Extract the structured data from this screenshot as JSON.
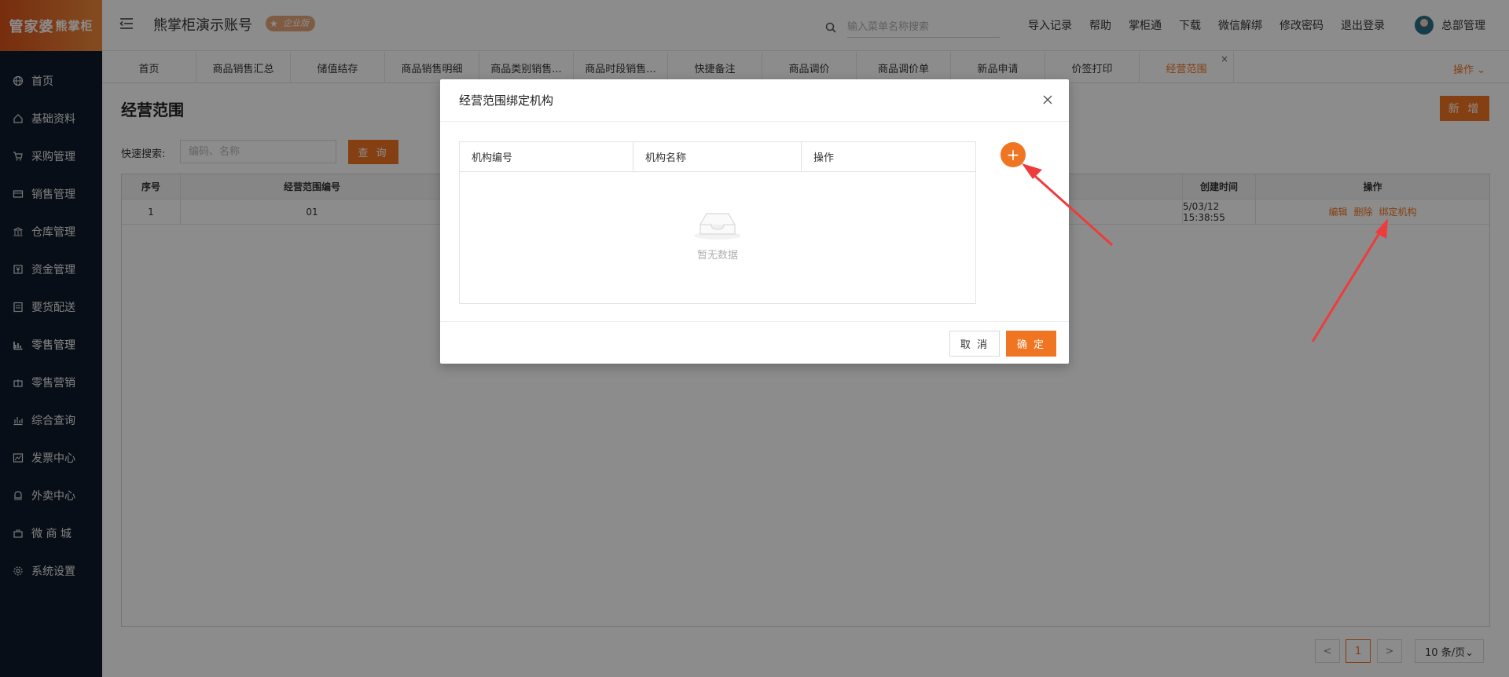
{
  "logo": {
    "text_a": "管家婆",
    "text_b": "熊掌柜"
  },
  "header": {
    "account": "熊掌柜演示账号",
    "edition": "企业版",
    "search_placeholder": "输入菜单名称搜索",
    "links": [
      "导入记录",
      "帮助",
      "掌柜通",
      "下载",
      "微信解绑",
      "修改密码",
      "退出登录"
    ],
    "user": "总部管理"
  },
  "sidebar": {
    "items": [
      {
        "label": "首页",
        "icon": "globe-icon"
      },
      {
        "label": "基础资料",
        "icon": "home-icon"
      },
      {
        "label": "采购管理",
        "icon": "cart-icon"
      },
      {
        "label": "销售管理",
        "icon": "card-icon"
      },
      {
        "label": "仓库管理",
        "icon": "bank-icon"
      },
      {
        "label": "资金管理",
        "icon": "money-icon"
      },
      {
        "label": "要货配送",
        "icon": "list-icon"
      },
      {
        "label": "零售管理",
        "icon": "chart-icon"
      },
      {
        "label": "零售营销",
        "icon": "gift-icon"
      },
      {
        "label": "综合查询",
        "icon": "bar-icon"
      },
      {
        "label": "发票中心",
        "icon": "trend-icon"
      },
      {
        "label": "外卖中心",
        "icon": "bell-icon"
      },
      {
        "label": "微 商 城",
        "icon": "bag-icon"
      },
      {
        "label": "系统设置",
        "icon": "gear-icon"
      }
    ]
  },
  "tabs": {
    "items": [
      "首页",
      "商品销售汇总",
      "储值结存",
      "商品销售明细",
      "商品类别销售...",
      "商品时段销售...",
      "快捷备注",
      "商品调价",
      "商品调价单",
      "新品申请",
      "价签打印",
      "经营范围"
    ],
    "active_index": 11,
    "ops_label": "操作 ⌄"
  },
  "page": {
    "title": "经营范围",
    "add_label": "新 增",
    "quick_search_label": "快速搜索:",
    "quick_search_placeholder": "编码、名称",
    "query_label": "查 询"
  },
  "table": {
    "headers": [
      "序号",
      "经营范围编号",
      "",
      "创建时间",
      "操作"
    ],
    "rows": [
      {
        "index": "1",
        "code": "01",
        "created": "5/03/12 15:38:55",
        "ops": [
          "编辑",
          "删除",
          "绑定机构"
        ]
      }
    ]
  },
  "pagination": {
    "prev": "<",
    "current": "1",
    "next": ">",
    "page_size": "10 条/页⌄"
  },
  "modal": {
    "title": "经营范围绑定机构",
    "headers": [
      "机构编号",
      "机构名称",
      "操作"
    ],
    "empty_text": "暂无数据",
    "add_symbol": "+",
    "cancel_label": "取 消",
    "ok_label": "确 定"
  },
  "colors": {
    "accent": "#f07522",
    "sidebar": "#0f1a2a",
    "overlay": "rgba(0,0,0,0.45)"
  }
}
